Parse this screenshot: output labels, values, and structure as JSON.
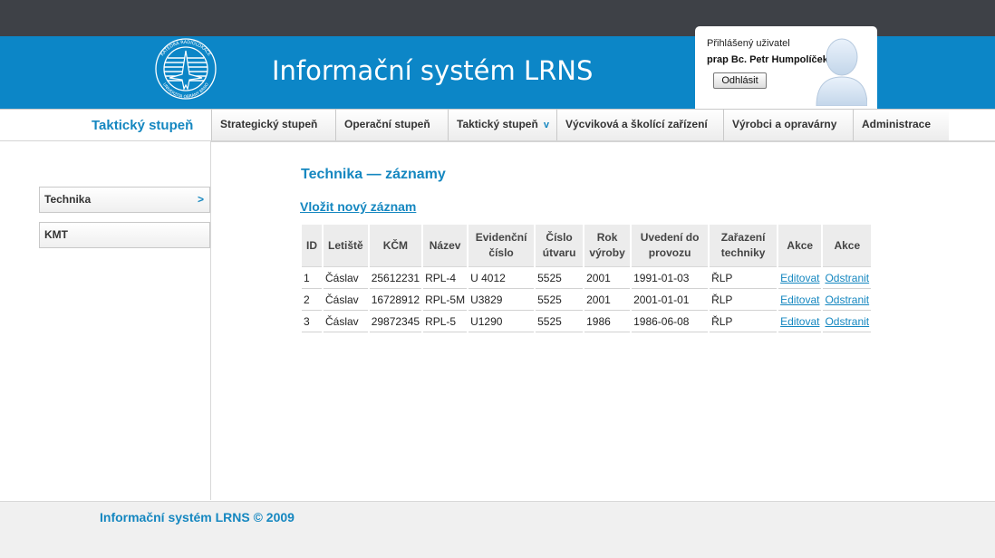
{
  "header": {
    "title": "Informační systém LRNS",
    "logo_text_top": "KATEDRA RADIOLOKACE",
    "logo_text_bottom": "UNIVERZITA OBRANY BRNO"
  },
  "user": {
    "label": "Přihlášený uživatel",
    "name": "prap Bc. Petr Humpolíček",
    "logout_label": "Odhlásit"
  },
  "nav": {
    "current": "Taktický stupeň",
    "items": [
      {
        "label": "Strategický stupeň"
      },
      {
        "label": "Operační stupeň"
      },
      {
        "label": "Taktický stupeň",
        "arrow": "v"
      },
      {
        "label": "Výcviková a školící zařízení"
      },
      {
        "label": "Výrobci a opravárny"
      },
      {
        "label": "Administrace"
      }
    ]
  },
  "sidebar": {
    "items": [
      {
        "label": "Technika",
        "arrow": ">"
      },
      {
        "label": "KMT"
      }
    ]
  },
  "main": {
    "title": "Technika — záznamy",
    "new_link": "Vložit nový záznam",
    "table": {
      "headers": [
        "ID",
        "Letiště",
        "KČM",
        "Název",
        "Evidenční číslo",
        "Číslo útvaru",
        "Rok výroby",
        "Uvedení do provozu",
        "Zařazení techniky",
        "Akce",
        "Akce"
      ],
      "rows": [
        {
          "id": "1",
          "letiste": "Čáslav",
          "kcm": "25612231",
          "nazev": "RPL-4",
          "evid": "U 4012",
          "utvar": "5525",
          "rok": "2001",
          "uvedeni": "1991-01-03",
          "zarazeni": "ŘLP",
          "edit": "Editovat",
          "remove": "Odstranit"
        },
        {
          "id": "2",
          "letiste": "Čáslav",
          "kcm": "16728912",
          "nazev": "RPL-5M",
          "evid": "U3829",
          "utvar": "5525",
          "rok": "2001",
          "uvedeni": "2001-01-01",
          "zarazeni": "ŘLP",
          "edit": "Editovat",
          "remove": "Odstranit"
        },
        {
          "id": "3",
          "letiste": "Čáslav",
          "kcm": "29872345",
          "nazev": "RPL-5",
          "evid": "U1290",
          "utvar": "5525",
          "rok": "1986",
          "uvedeni": "1986-06-08",
          "zarazeni": "ŘLP",
          "edit": "Editovat",
          "remove": "Odstranit"
        }
      ]
    }
  },
  "footer": {
    "text": "Informační systém LRNS © 2009"
  },
  "colors": {
    "brand_blue": "#0c86c7",
    "accent_text": "#1587c0",
    "topbar": "#3e4147"
  },
  "icons": {
    "logo": "radar-emblem-icon",
    "avatar": "user-silhouette-icon"
  }
}
